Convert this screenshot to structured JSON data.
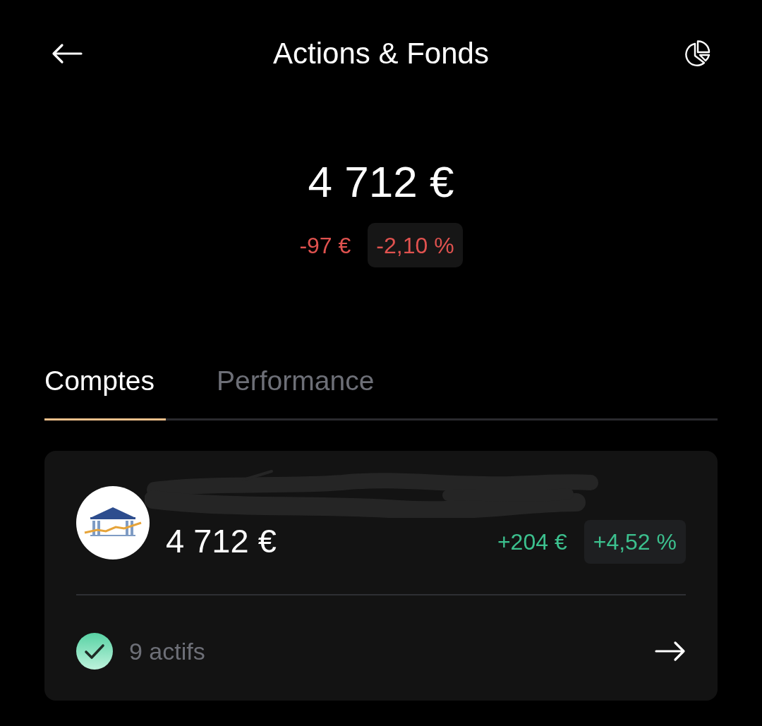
{
  "header": {
    "title": "Actions & Fonds"
  },
  "summary": {
    "total": "4 712 €",
    "negative": true,
    "change": "-97 €",
    "change_percent": "-2,10 %"
  },
  "tabs": [
    {
      "label": "Comptes",
      "selected": true
    },
    {
      "label": "Performance",
      "selected": false
    }
  ],
  "accounts": [
    {
      "value": "4 712 €",
      "negative": false,
      "change": "+204 €",
      "change_percent": "+4,52 %",
      "assets": "9 actifs"
    }
  ]
}
